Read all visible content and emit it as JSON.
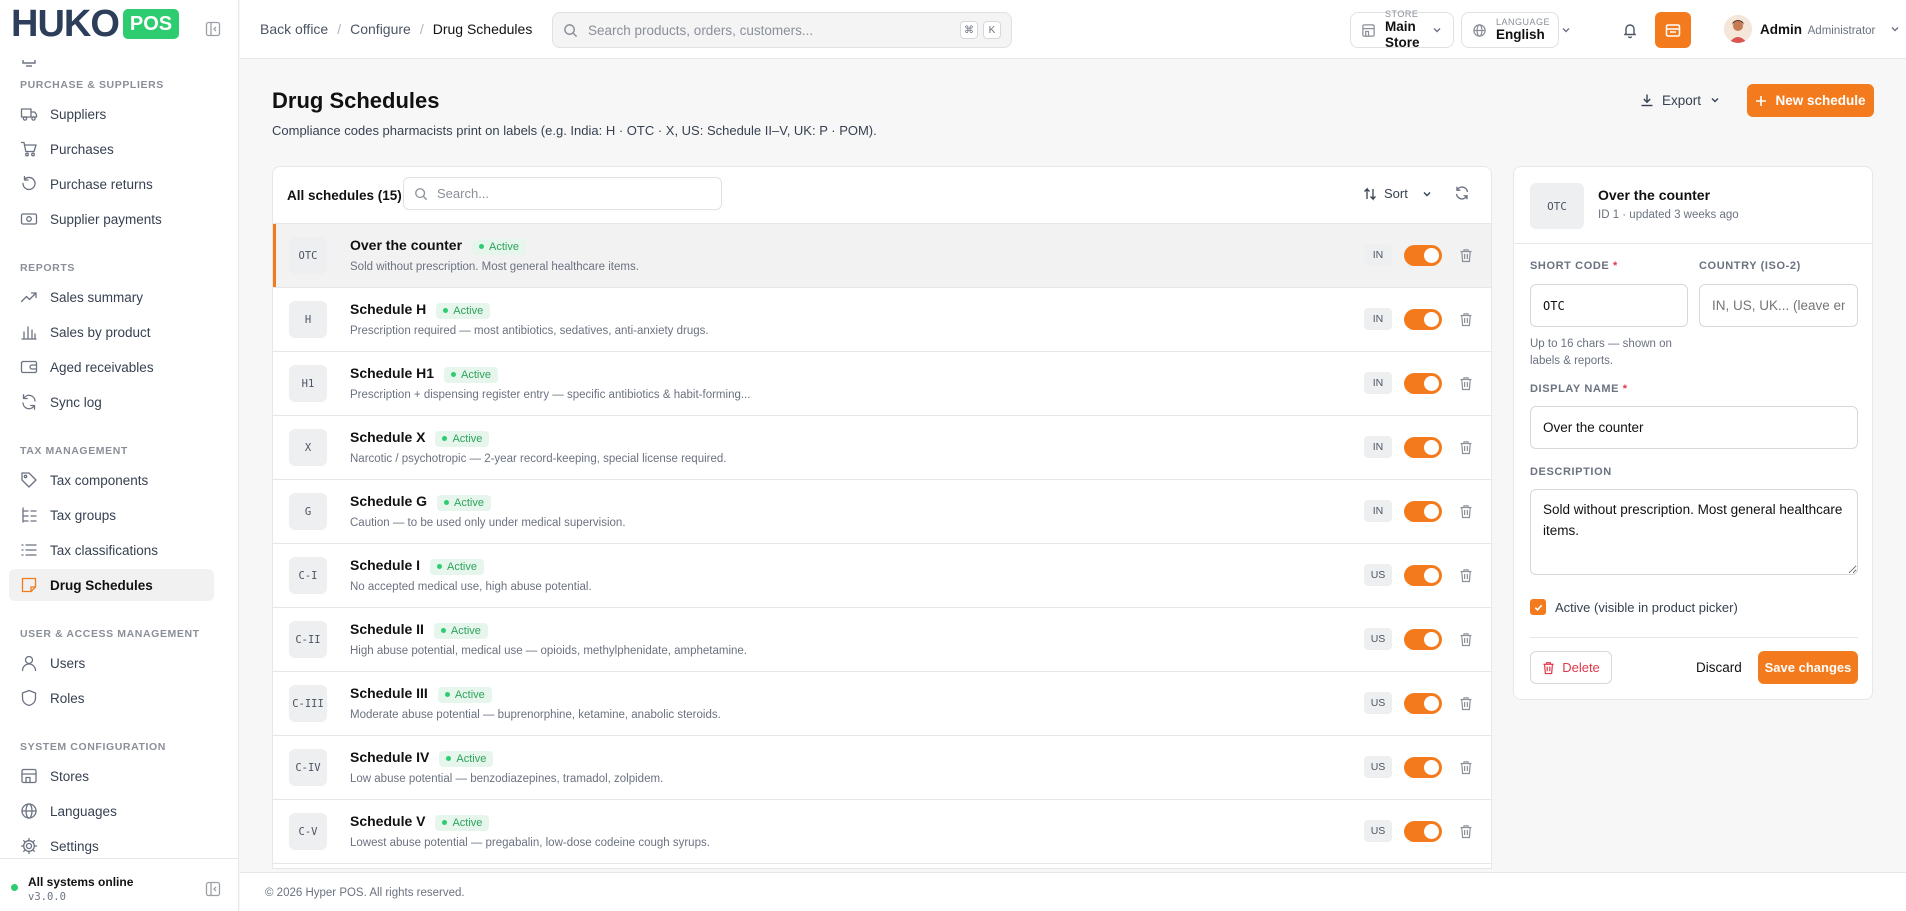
{
  "brand": {
    "word": "HUKO",
    "pos": "POS",
    "brand_color": "#f47b1d",
    "logo_color": "#2c3e5a",
    "pos_color": "#2ecc71"
  },
  "sidebar": {
    "sections": [
      {
        "title": "Purchase & Suppliers",
        "items": [
          {
            "label": "Suppliers",
            "icon": "truck-icon"
          },
          {
            "label": "Purchases",
            "icon": "cart-icon"
          },
          {
            "label": "Purchase returns",
            "icon": "undo-icon"
          },
          {
            "label": "Supplier payments",
            "icon": "money-icon"
          }
        ]
      },
      {
        "title": "Reports",
        "items": [
          {
            "label": "Sales summary",
            "icon": "trend-icon"
          },
          {
            "label": "Sales by product",
            "icon": "bar-chart-icon"
          },
          {
            "label": "Aged receivables",
            "icon": "wallet-icon"
          },
          {
            "label": "Sync log",
            "icon": "sync-icon"
          }
        ]
      },
      {
        "title": "Tax Management",
        "items": [
          {
            "label": "Tax components",
            "icon": "tag-icon"
          },
          {
            "label": "Tax groups",
            "icon": "tree-icon"
          },
          {
            "label": "Tax classifications",
            "icon": "list-icon"
          },
          {
            "label": "Drug Schedules",
            "icon": "note-icon",
            "active": true
          }
        ]
      },
      {
        "title": "User & Access Management",
        "items": [
          {
            "label": "Users",
            "icon": "user-icon"
          },
          {
            "label": "Roles",
            "icon": "shield-icon"
          }
        ]
      },
      {
        "title": "System Configuration",
        "items": [
          {
            "label": "Stores",
            "icon": "store-icon"
          },
          {
            "label": "Languages",
            "icon": "globe-icon"
          },
          {
            "label": "Settings",
            "icon": "gear-icon"
          }
        ]
      }
    ],
    "status_text": "All systems online",
    "version": "v3.0.0"
  },
  "topbar": {
    "breadcrumbs": [
      "Back office",
      "Configure",
      "Drug Schedules"
    ],
    "search_placeholder": "Search products, orders, customers...",
    "shortcut_keys": [
      "⌘",
      "K"
    ],
    "store_label": "Store",
    "store_value": "Main Store",
    "language_label": "Language",
    "language_value": "English",
    "user_name": "Admin",
    "user_role": "Administrator"
  },
  "page": {
    "title": "Drug Schedules",
    "subtitle": "Compliance codes pharmacists print on labels (e.g. India: H · OTC · X, US: Schedule II–V, UK: P · POM).",
    "export_label": "Export",
    "new_label": "New schedule"
  },
  "list": {
    "title": "All schedules (15)",
    "search_placeholder": "Search...",
    "sort_label": "Sort",
    "status_label": "Active",
    "rows": [
      {
        "code": "OTC",
        "name": "Over the counter",
        "desc": "Sold without prescription. Most general healthcare items.",
        "country": "IN",
        "active": true,
        "selected": true
      },
      {
        "code": "H",
        "name": "Schedule H",
        "desc": "Prescription required — most antibiotics, sedatives, anti-anxiety drugs.",
        "country": "IN",
        "active": true
      },
      {
        "code": "H1",
        "name": "Schedule H1",
        "desc": "Prescription + dispensing register entry — specific antibiotics & habit-forming...",
        "country": "IN",
        "active": true
      },
      {
        "code": "X",
        "name": "Schedule X",
        "desc": "Narcotic / psychotropic — 2-year record-keeping, special license required.",
        "country": "IN",
        "active": true
      },
      {
        "code": "G",
        "name": "Schedule G",
        "desc": "Caution — to be used only under medical supervision.",
        "country": "IN",
        "active": true
      },
      {
        "code": "C-I",
        "name": "Schedule I",
        "desc": "No accepted medical use, high abuse potential.",
        "country": "US",
        "active": true
      },
      {
        "code": "C-II",
        "name": "Schedule II",
        "desc": "High abuse potential, medical use — opioids, methylphenidate, amphetamine.",
        "country": "US",
        "active": true
      },
      {
        "code": "C-III",
        "name": "Schedule III",
        "desc": "Moderate abuse potential — buprenorphine, ketamine, anabolic steroids.",
        "country": "US",
        "active": true
      },
      {
        "code": "C-IV",
        "name": "Schedule IV",
        "desc": "Low abuse potential — benzodiazepines, tramadol, zolpidem.",
        "country": "US",
        "active": true
      },
      {
        "code": "C-V",
        "name": "Schedule V",
        "desc": "Lowest abuse potential — pregabalin, low-dose codeine cough syrups.",
        "country": "US",
        "active": true
      }
    ]
  },
  "detail": {
    "code": "OTC",
    "name": "Over the counter",
    "meta": "ID 1 · updated 3 weeks ago",
    "short_code_label": "Short code",
    "short_code_value": "OTC",
    "short_code_help": "Up to 16 chars — shown on labels & reports.",
    "country_label": "Country (ISO-2)",
    "country_placeholder": "IN, US, UK... (leave empty for global)",
    "display_name_label": "Display name",
    "display_name_value": "Over the counter",
    "description_label": "Description",
    "description_value": "Sold without prescription. Most general healthcare items.",
    "active_label": "Active (visible in product picker)",
    "active_checked": true,
    "delete_label": "Delete",
    "discard_label": "Discard",
    "save_label": "Save changes",
    "required_mark": "*"
  },
  "footer": {
    "text": "© 2026 Hyper POS. All rights reserved."
  }
}
